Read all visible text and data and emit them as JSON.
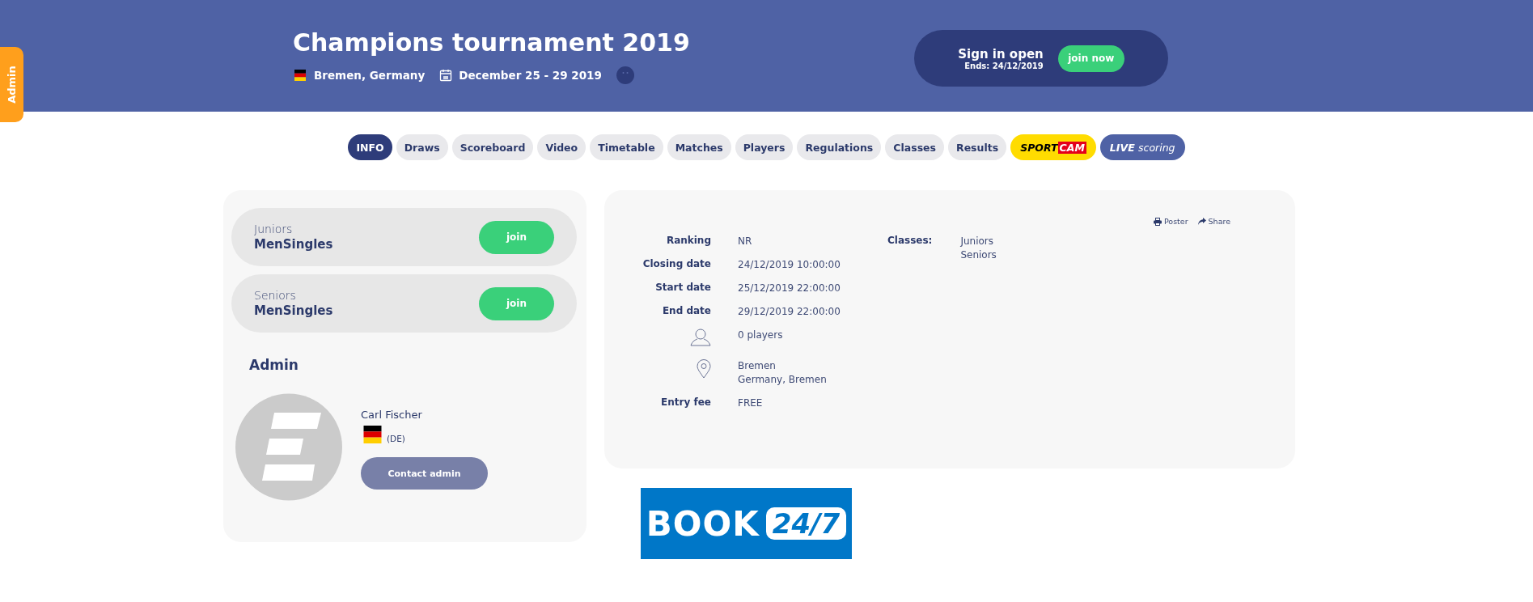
{
  "side_tab": {
    "label": "Admin"
  },
  "header": {
    "title": "Champions tournament 2019",
    "location": "Bremen, Germany",
    "dates": "December 25 - 29 2019",
    "signin": {
      "title": "Sign in open",
      "ends": "Ends: 24/12/2019",
      "button": "join now"
    }
  },
  "tabs": [
    {
      "kind": "plain",
      "label": "INFO",
      "selected": true
    },
    {
      "kind": "plain",
      "label": "Draws",
      "selected": false
    },
    {
      "kind": "plain",
      "label": "Scoreboard",
      "selected": false
    },
    {
      "kind": "plain",
      "label": "Video",
      "selected": false
    },
    {
      "kind": "plain",
      "label": "Timetable",
      "selected": false
    },
    {
      "kind": "plain",
      "label": "Matches",
      "selected": false
    },
    {
      "kind": "plain",
      "label": "Players",
      "selected": false
    },
    {
      "kind": "plain",
      "label": "Regulations",
      "selected": false
    },
    {
      "kind": "plain",
      "label": "Classes",
      "selected": false
    },
    {
      "kind": "plain",
      "label": "Results",
      "selected": false
    },
    {
      "kind": "sportcam",
      "parts": [
        "SPORT",
        "CAM"
      ],
      "selected": false
    },
    {
      "kind": "live",
      "parts": [
        "LIVE",
        "scoring"
      ],
      "selected": false
    }
  ],
  "classes": [
    {
      "group": "Juniors",
      "event": "MenSingles",
      "button": "join"
    },
    {
      "group": "Seniors",
      "event": "MenSingles",
      "button": "join"
    }
  ],
  "admin": {
    "heading": "Admin",
    "name": "Carl Fischer",
    "country": "(DE)",
    "button": "Contact admin"
  },
  "details": {
    "actions": [
      "Poster",
      "Share"
    ],
    "rows": [
      {
        "kind": "label",
        "label": "Ranking",
        "values": [
          "NR"
        ]
      },
      {
        "kind": "label",
        "label": "Closing date",
        "values": [
          "24/12/2019 10:00:00"
        ]
      },
      {
        "kind": "label",
        "label": "Start date",
        "values": [
          "25/12/2019 22:00:00"
        ]
      },
      {
        "kind": "label",
        "label": "End date",
        "values": [
          "29/12/2019 22:00:00"
        ]
      },
      {
        "kind": "players",
        "values": [
          "0 players"
        ]
      },
      {
        "kind": "location",
        "values": [
          "Bremen",
          "Germany, Bremen"
        ]
      },
      {
        "kind": "label",
        "label": "Entry fee",
        "values": [
          "FREE"
        ]
      }
    ],
    "classes_label": "Classes:",
    "classes": [
      "Juniors",
      "Seniors"
    ]
  },
  "banner": {
    "word": "BOOK",
    "badge": "24/7"
  }
}
